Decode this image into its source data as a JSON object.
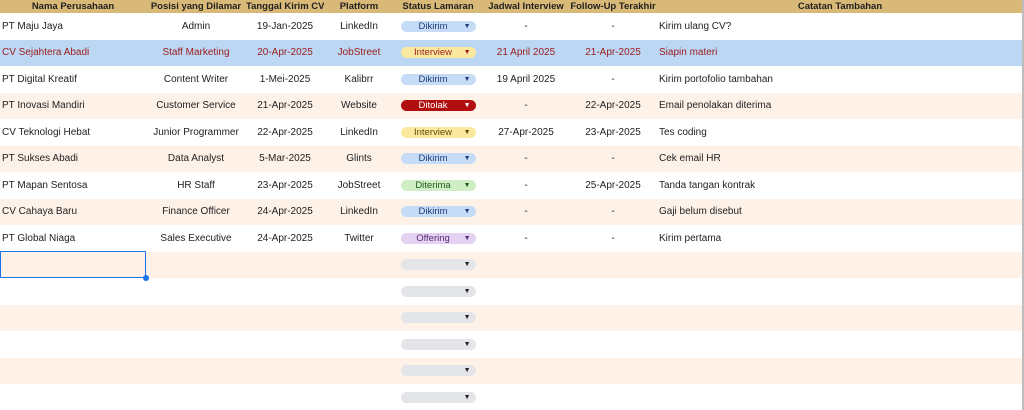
{
  "headers": [
    {
      "key": "company",
      "label": "Nama Perusahaan"
    },
    {
      "key": "position",
      "label": "Posisi yang Dilamar"
    },
    {
      "key": "sent",
      "label": "Tanggal Kirim CV"
    },
    {
      "key": "platform",
      "label": "Platform"
    },
    {
      "key": "status",
      "label": "Status Lamaran"
    },
    {
      "key": "interview",
      "label": "Jadwal Interview"
    },
    {
      "key": "followup",
      "label": "Follow-Up Terakhir"
    },
    {
      "key": "notes",
      "label": "Catatan Tambahan"
    }
  ],
  "status_colors": {
    "Dikirim": {
      "bg": "#c6dbf6",
      "fg": "#1f3f7a"
    },
    "Interview": {
      "bg": "#fbe9a0",
      "fg": "#6b4a00"
    },
    "Ditolak": {
      "bg": "#b10f0f",
      "fg": "#ffffff"
    },
    "Diterima": {
      "bg": "#cfeec4",
      "fg": "#1f5a1f"
    },
    "Offering": {
      "bg": "#e4d2f2",
      "fg": "#5a2b7a"
    }
  },
  "dropdown_icon": "dropdown-arrow-icon",
  "rows": [
    {
      "company": "PT Maju Jaya",
      "position": "Admin",
      "sent": "19-Jan-2025",
      "platform": "LinkedIn",
      "status": "Dikirim",
      "interview": "-",
      "followup": "-",
      "notes": "Kirim ulang CV?"
    },
    {
      "company": "CV Sejahtera Abadi",
      "position": "Staff Marketing",
      "sent": "20-Apr-2025",
      "platform": "JobStreet",
      "status": "Interview",
      "interview": "21 April 2025",
      "followup": "21-Apr-2025",
      "notes": "Siapin materi",
      "selected": true
    },
    {
      "company": "PT Digital Kreatif",
      "position": "Content Writer",
      "sent": "1-Mei-2025",
      "platform": "Kalibrr",
      "status": "Dikirim",
      "interview": "19 April 2025",
      "followup": "-",
      "notes": "Kirim portofolio tambahan"
    },
    {
      "company": "PT Inovasi Mandiri",
      "position": "Customer Service",
      "sent": "21-Apr-2025",
      "platform": "Website",
      "status": "Ditolak",
      "interview": "-",
      "followup": "22-Apr-2025",
      "notes": "Email penolakan diterima"
    },
    {
      "company": "CV Teknologi Hebat",
      "position": "Junior Programmer",
      "sent": "22-Apr-2025",
      "platform": "LinkedIn",
      "status": "Interview",
      "interview": "27-Apr-2025",
      "followup": "23-Apr-2025",
      "notes": "Tes coding"
    },
    {
      "company": "PT Sukses Abadi",
      "position": "Data Analyst",
      "sent": "5-Mar-2025",
      "platform": "Glints",
      "status": "Dikirim",
      "interview": "-",
      "followup": "-",
      "notes": "Cek email HR"
    },
    {
      "company": "PT Mapan Sentosa",
      "position": "HR Staff",
      "sent": "23-Apr-2025",
      "platform": "JobStreet",
      "status": "Diterima",
      "interview": "-",
      "followup": "25-Apr-2025",
      "notes": "Tanda tangan kontrak"
    },
    {
      "company": "CV Cahaya Baru",
      "position": "Finance Officer",
      "sent": "24-Apr-2025",
      "platform": "LinkedIn",
      "status": "Dikirim",
      "interview": "-",
      "followup": "-",
      "notes": "Gaji belum disebut"
    },
    {
      "company": "PT Global Niaga",
      "position": "Sales Executive",
      "sent": "24-Apr-2025",
      "platform": "Twitter",
      "status": "Offering",
      "interview": "-",
      "followup": "-",
      "notes": "Kirim pertama"
    },
    {
      "company": "",
      "position": "",
      "sent": "",
      "platform": "",
      "status": "",
      "interview": "",
      "followup": "",
      "notes": ""
    },
    {
      "company": "",
      "position": "",
      "sent": "",
      "platform": "",
      "status": "",
      "interview": "",
      "followup": "",
      "notes": ""
    },
    {
      "company": "",
      "position": "",
      "sent": "",
      "platform": "",
      "status": "",
      "interview": "",
      "followup": "",
      "notes": ""
    },
    {
      "company": "",
      "position": "",
      "sent": "",
      "platform": "",
      "status": "",
      "interview": "",
      "followup": "",
      "notes": ""
    },
    {
      "company": "",
      "position": "",
      "sent": "",
      "platform": "",
      "status": "",
      "interview": "",
      "followup": "",
      "notes": ""
    },
    {
      "company": "",
      "position": "",
      "sent": "",
      "platform": "",
      "status": "",
      "interview": "",
      "followup": "",
      "notes": ""
    }
  ]
}
